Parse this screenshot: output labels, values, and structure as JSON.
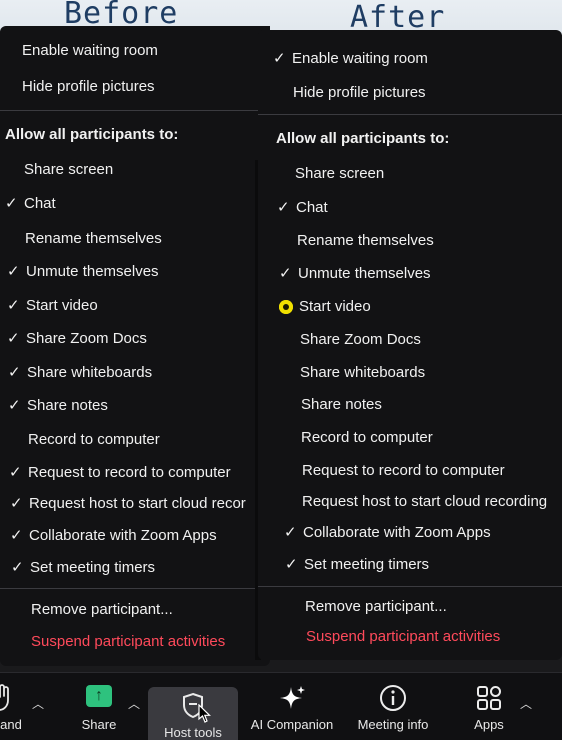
{
  "captions": {
    "before": "Before",
    "after": "After"
  },
  "left_panel": {
    "items": [
      {
        "label": "Enable waiting room",
        "checked": false
      },
      {
        "label": "Hide profile pictures",
        "checked": false
      },
      {
        "label": "Allow all participants to:",
        "header": true
      },
      {
        "label": "Share screen",
        "checked": false
      },
      {
        "label": "Chat",
        "checked": true
      },
      {
        "label": "Rename themselves",
        "checked": false
      },
      {
        "label": "Unmute themselves",
        "checked": true
      },
      {
        "label": "Start video",
        "checked": true
      },
      {
        "label": "Share Zoom Docs",
        "checked": true
      },
      {
        "label": "Share whiteboards",
        "checked": true
      },
      {
        "label": "Share notes",
        "checked": true
      },
      {
        "label": "Record to computer",
        "checked": false
      },
      {
        "label": "Request to record to computer",
        "checked": true
      },
      {
        "label": "Request host to start cloud recor",
        "checked": true
      },
      {
        "label": "Collaborate with Zoom Apps",
        "checked": true
      },
      {
        "label": "Set meeting timers",
        "checked": true
      },
      {
        "label": "Remove participant...",
        "checked": false
      },
      {
        "label": "Suspend participant activities",
        "danger": true
      }
    ]
  },
  "right_panel": {
    "items": [
      {
        "label": "Enable waiting room",
        "checked": true
      },
      {
        "label": "Hide profile pictures",
        "checked": false
      },
      {
        "label": "Allow all participants to:",
        "header": true
      },
      {
        "label": "Share screen",
        "checked": false
      },
      {
        "label": "Chat",
        "checked": true
      },
      {
        "label": "Rename themselves",
        "checked": false
      },
      {
        "label": "Unmute themselves",
        "checked": true
      },
      {
        "label": "Start video",
        "checked": false,
        "highlight": "yellow"
      },
      {
        "label": "Share Zoom Docs",
        "checked": false
      },
      {
        "label": "Share whiteboards",
        "checked": false
      },
      {
        "label": "Share notes",
        "checked": false
      },
      {
        "label": "Record to computer",
        "checked": false
      },
      {
        "label": "Request to record to computer",
        "checked": false
      },
      {
        "label": "Request host to start cloud recording",
        "checked": false
      },
      {
        "label": "Collaborate with Zoom Apps",
        "checked": true
      },
      {
        "label": "Set meeting timers",
        "checked": true
      },
      {
        "label": "Remove participant...",
        "checked": false
      },
      {
        "label": "Suspend participant activities",
        "danger": true
      }
    ]
  },
  "toolbar": {
    "items": [
      {
        "label": "e hand",
        "icon": "raise-hand-icon"
      },
      {
        "label": "Share",
        "icon": "share-screen-icon"
      },
      {
        "label": "Host tools",
        "icon": "shield-icon",
        "active": true
      },
      {
        "label": "AI Companion",
        "icon": "sparkle-icon"
      },
      {
        "label": "Meeting info",
        "icon": "info-icon"
      },
      {
        "label": "Apps",
        "icon": "apps-icon"
      }
    ]
  },
  "colors": {
    "danger": "#ff4a5b",
    "share_green": "#2ec27e",
    "highlight": "#f0e000"
  }
}
